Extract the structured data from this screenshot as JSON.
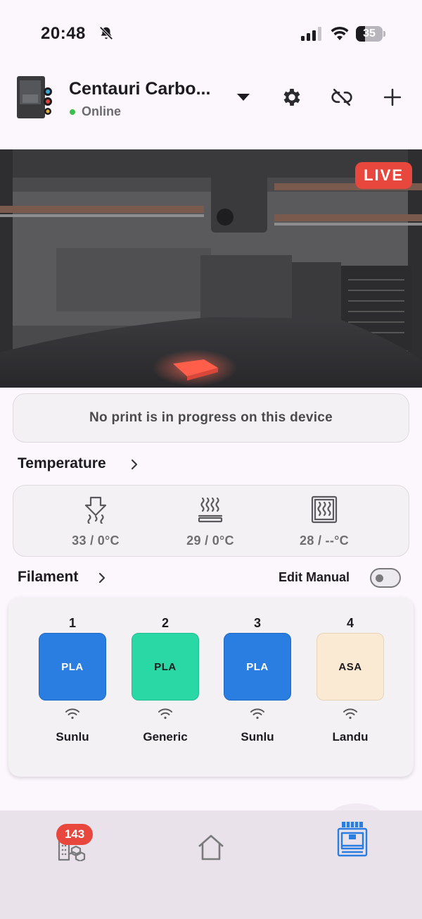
{
  "status_bar": {
    "time": "20:48",
    "battery": "35",
    "battery_level": 0.35
  },
  "header": {
    "printer_name": "Centauri Carbo...",
    "status": "Online",
    "status_color": "#3cbf4d",
    "icons": [
      "dropdown-arrow-icon",
      "gear-icon",
      "link-off-icon",
      "plus-icon"
    ]
  },
  "camera": {
    "live_label": "LIVE"
  },
  "print_status": {
    "message": "No print is in progress on this device"
  },
  "temperature": {
    "title": "Temperature",
    "items": [
      {
        "icon": "nozzle-icon",
        "value": "33 / 0°C"
      },
      {
        "icon": "heatbed-icon",
        "value": "29 / 0°C"
      },
      {
        "icon": "chamber-icon",
        "value": "28 / --°C"
      }
    ]
  },
  "filament": {
    "title": "Filament",
    "edit_manual_label": "Edit Manual",
    "edit_manual_on": false,
    "slots": [
      {
        "number": "1",
        "type": "PLA",
        "color": "#2a7de1",
        "text_color": "#ffffff",
        "brand": "Sunlu"
      },
      {
        "number": "2",
        "type": "PLA",
        "color": "#2ad8a6",
        "text_color": "#1c1b1f",
        "brand": "Generic"
      },
      {
        "number": "3",
        "type": "PLA",
        "color": "#2a7de1",
        "text_color": "#ffffff",
        "brand": "Sunlu"
      },
      {
        "number": "4",
        "type": "ASA",
        "color": "#fbead3",
        "text_color": "#1c1b1f",
        "brand": "Landu"
      }
    ]
  },
  "bottom_nav": {
    "badge_count": "143",
    "items": [
      "models-icon",
      "home-icon",
      "printer-icon"
    ],
    "active_color": "#2a7de1"
  }
}
